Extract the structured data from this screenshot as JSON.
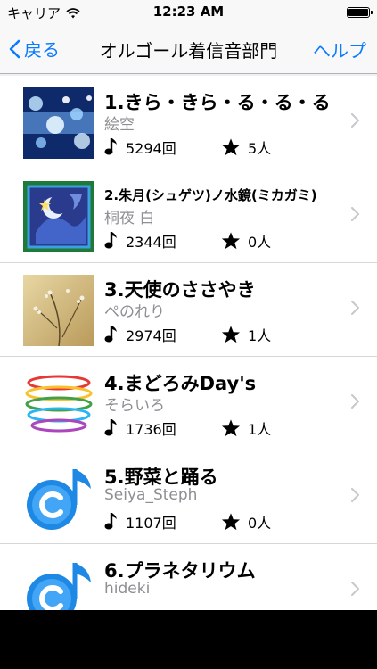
{
  "statusbar": {
    "carrier": "キャリア",
    "time": "12:23 AM"
  },
  "navbar": {
    "back_label": "戻る",
    "title": "オルゴール着信音部門",
    "help_label": "ヘルプ"
  },
  "songs": [
    {
      "title": "1.きら・きら・る・る・る",
      "artist": "絵空",
      "plays": "5294回",
      "likes": "5人"
    },
    {
      "title": "2.朱月(シュゲツ)ノ水鏡(ミカガミ)",
      "artist": "桐夜 白",
      "plays": "2344回",
      "likes": "0人"
    },
    {
      "title": "3.天使のささやき",
      "artist": "ぺのれり",
      "plays": "2974回",
      "likes": "1人"
    },
    {
      "title": "4.まどろみDay's",
      "artist": "そらいろ",
      "plays": "1736回",
      "likes": "1人"
    },
    {
      "title": "5.野菜と踊る",
      "artist": "Seiya_Steph",
      "plays": "1107回",
      "likes": "0人"
    },
    {
      "title": "6.プラネタリウム",
      "artist": "hideki",
      "plays": "",
      "likes": ""
    }
  ],
  "icons": {
    "plays": "music-note-icon",
    "likes": "star-icon",
    "disclosure": "chevron-right-icon"
  },
  "colors": {
    "accent": "#0a7aff",
    "secondary_text": "#8e8e93"
  }
}
